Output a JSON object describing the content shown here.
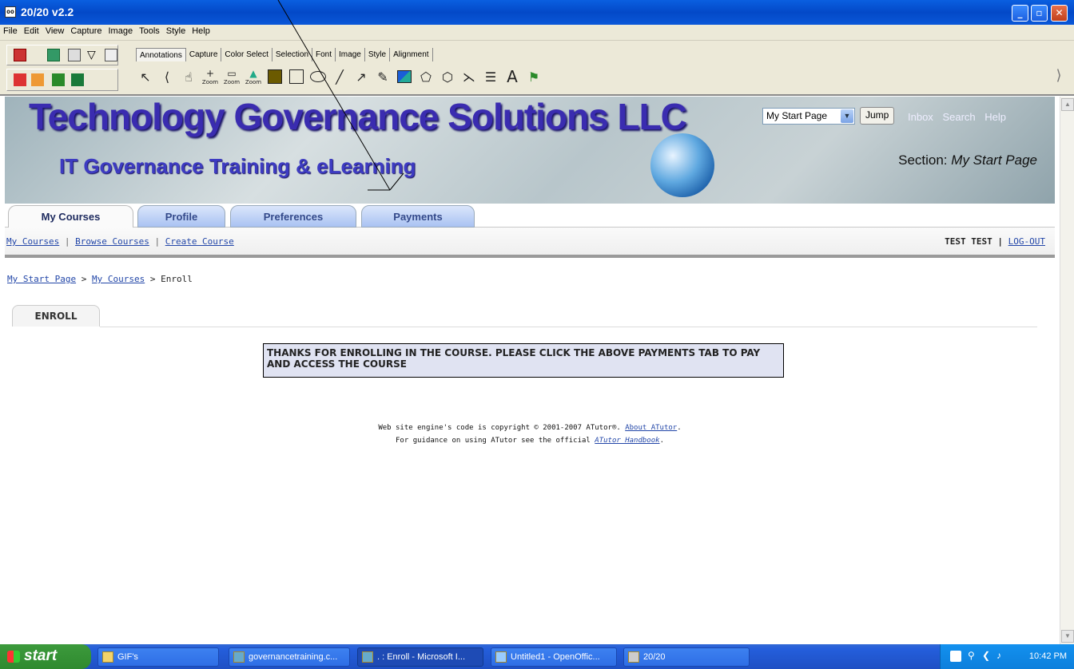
{
  "window": {
    "title": "20/20 v2.2",
    "buttons": [
      "_",
      "▫",
      "✕"
    ]
  },
  "menu": [
    "File",
    "Edit",
    "View",
    "Capture",
    "Image",
    "Tools",
    "Style",
    "Help"
  ],
  "toolbar": {
    "tabs": [
      "Annotations",
      "Capture",
      "Color Select",
      "Selection",
      "Font",
      "Image",
      "Style",
      "Alignment"
    ],
    "tools": [
      "arrow-select",
      "back",
      "hand",
      "zoom-in",
      "zoom-out",
      "zoom-fit",
      "fill-rect",
      "rectangle",
      "ellipse",
      "line",
      "arrow",
      "pen",
      "image",
      "poly-select",
      "poly",
      "spline",
      "text-box",
      "text",
      "stamp"
    ],
    "zoom_labels": [
      "Zoom",
      "Zoom",
      "Zoom"
    ]
  },
  "banner": {
    "title": "Technology Governance Solutions LLC",
    "subtitle": "IT Governance Training & eLearning",
    "jump_select": "My Start Page",
    "jump_button": "Jump",
    "top_links": [
      "Inbox",
      "Search",
      "Help"
    ],
    "section_label": "Section:",
    "section_value": "My Start Page"
  },
  "tabs": [
    "My Courses",
    "Profile",
    "Preferences",
    "Payments"
  ],
  "subnav": {
    "links": [
      "My Courses",
      "Browse Courses",
      "Create Course"
    ],
    "user": "TEST TEST",
    "logout": "LOG-OUT"
  },
  "breadcrumb": {
    "items": [
      "My Start Page",
      "My Courses"
    ],
    "current": "Enroll",
    "separator": ">"
  },
  "page_tab": "ENROLL",
  "message": "THANKS FOR ENROLLING IN THE COURSE. PLEASE CLICK THE ABOVE PAYMENTS TAB TO PAY AND ACCESS THE COURSE",
  "footer": {
    "line1": "Web site engine's code is copyright © 2001-2007 ATutor®.",
    "line1_link": "About ATutor",
    "line2": "For guidance on using ATutor see the official",
    "line2_link": "ATutor Handbook"
  },
  "taskbar": {
    "start": "start",
    "tasks": [
      "GIF's",
      "governancetraining.c...",
      ". : Enroll - Microsoft I...",
      "Untitled1 - OpenOffic...",
      "20/20"
    ],
    "clock": "10:42 PM"
  },
  "colors": {
    "title_blue": "#0a5fe0",
    "tab_blue": "#a9c2f2",
    "banner_text": "#3a2cb0",
    "message_bg": "#e0e3f2"
  }
}
